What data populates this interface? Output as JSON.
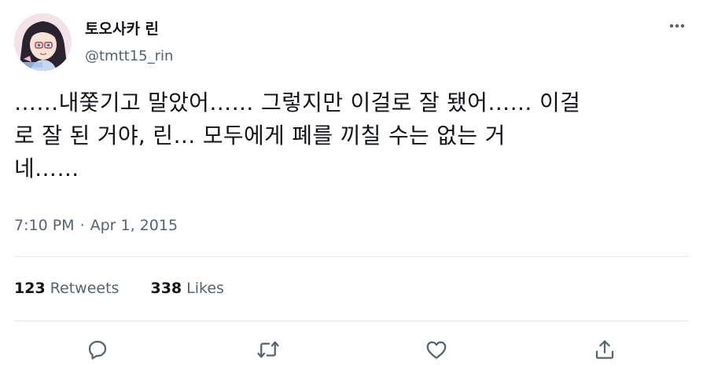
{
  "tweet": {
    "author": {
      "display_name": "토오사카 린",
      "handle": "@tmtt15_rin"
    },
    "text_lines": [
      "……내쫓기고 말았어…… 그렇지만 이걸로 잘 됐어…… 이걸",
      "로 잘 된 거야, 린… 모두에게 폐를 끼칠 수는 없는 거",
      "네……"
    ],
    "time": "7:10 PM",
    "separator": "·",
    "date": "Apr 1, 2015",
    "stats": {
      "retweets_count": "123",
      "retweets_label": "Retweets",
      "likes_count": "338",
      "likes_label": "Likes"
    }
  },
  "icons": {
    "more": "more-horizontal-icon",
    "reply": "speech-bubble-icon",
    "retweet": "retweet-arrows-icon",
    "like": "heart-icon",
    "share": "share-upload-icon"
  },
  "colors": {
    "text_primary": "#0f1419",
    "text_secondary": "#536471",
    "divider": "#e2e6e9"
  }
}
